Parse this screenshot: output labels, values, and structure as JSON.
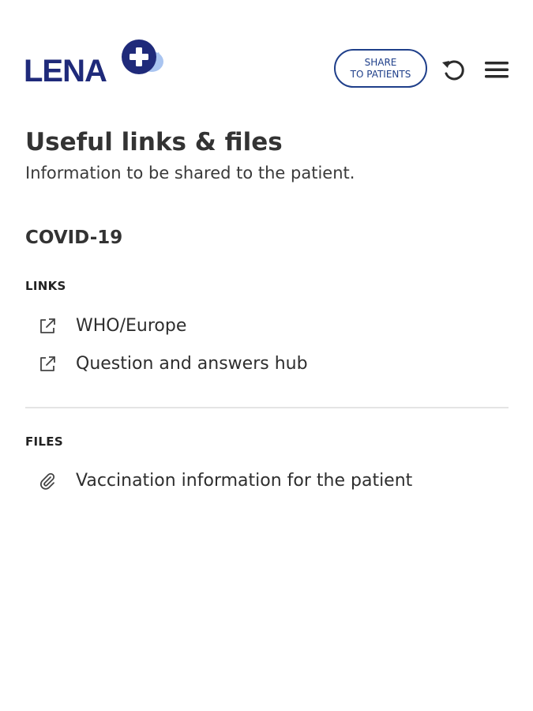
{
  "header": {
    "logo_text": "LENA",
    "share_button": {
      "line1": "SHARE",
      "line2": "TO PATIENTS"
    },
    "refresh_icon": "refresh-icon",
    "menu_icon": "hamburger-menu-icon"
  },
  "page": {
    "title": "Useful links & files",
    "subtitle": "Information to be shared to the patient."
  },
  "section": {
    "title": "COVID-19",
    "links_label": "LINKS",
    "links": [
      {
        "label": "WHO/Europe",
        "icon": "external-link-icon"
      },
      {
        "label": "Question and answers hub",
        "icon": "external-link-icon"
      }
    ],
    "files_label": "FILES",
    "files": [
      {
        "label": "Vaccination information for the patient",
        "icon": "paperclip-icon"
      }
    ]
  },
  "colors": {
    "brand_navy": "#1f2a7a",
    "badge_light_blue": "#a9c4f0",
    "button_border": "#1f3f8a",
    "text": "#2b2b2b",
    "divider": "#e4e4e4"
  }
}
